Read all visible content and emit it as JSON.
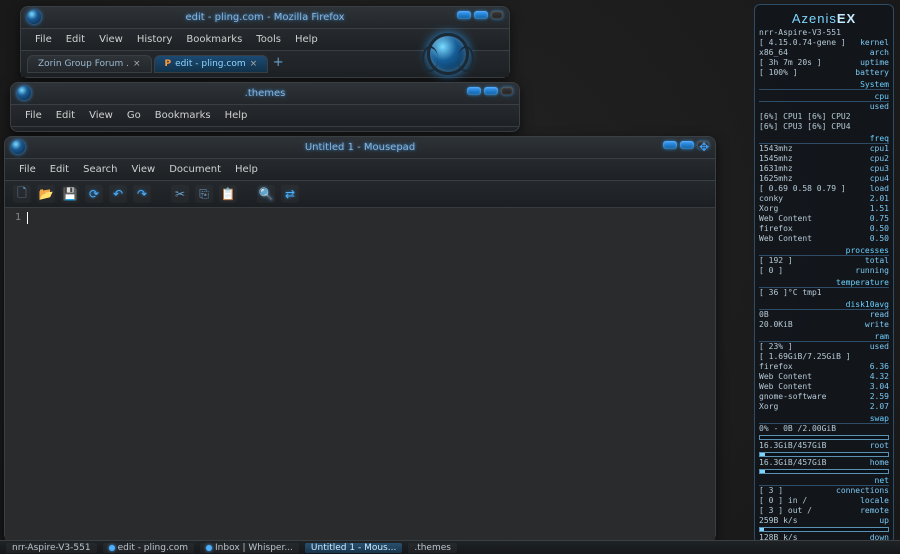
{
  "firefox": {
    "title": "edit - pling.com - Mozilla Firefox",
    "menu": [
      "File",
      "Edit",
      "View",
      "History",
      "Bookmarks",
      "Tools",
      "Help"
    ],
    "tabs": [
      {
        "label": "Zorin Group Forum .",
        "close": "×"
      },
      {
        "label": "edit - pling.com",
        "close": "×",
        "active": true
      }
    ],
    "plus": "+"
  },
  "filemanager": {
    "title": ".themes",
    "menu": [
      "File",
      "Edit",
      "View",
      "Go",
      "Bookmarks",
      "Help"
    ]
  },
  "mousepad": {
    "title": "Untitled 1 - Mousepad",
    "menu": [
      "File",
      "Edit",
      "Search",
      "View",
      "Document",
      "Help"
    ],
    "line": "1"
  },
  "conky": {
    "brand_a": "Azenis",
    "brand_b": "EX",
    "host": "nrr-Aspire-V3-551",
    "kernel_l": "[ 4.15.0.74-gene ]",
    "kernel_r": "kernel",
    "arch_l": "x86_64",
    "arch_r": "arch",
    "uptime_l": "[ 3h 7m 20s ]",
    "uptime_r": "uptime",
    "battery_l": "[ 100% ]",
    "battery_r": "battery",
    "h_system": "System",
    "h_cpu": "cpu",
    "cpu_used": "used",
    "cpu12": "[6%] CPU1  [6%] CPU2",
    "cpu34": "[6%] CPU3  [6%] CPU4",
    "h_freq": "freq",
    "f1": "1543mhz",
    "f1r": "cpu1",
    "f2": "1545mhz",
    "f2r": "cpu2",
    "f3": "1631mhz",
    "f3r": "cpu3",
    "f4": "1625mhz",
    "f4r": "cpu4",
    "load": "[ 0.69 0.58 0.79 ]",
    "load_r": "load",
    "p1": "conky",
    "p1v": "2.01",
    "p2": "Xorg",
    "p2v": "1.51",
    "p3": "Web Content",
    "p3v": "0.75",
    "p4": "firefox",
    "p4v": "0.50",
    "p5": "Web Content",
    "p5v": "0.50",
    "h_proc": "processes",
    "proc_total": "[ 192 ]",
    "proc_total_r": "total",
    "proc_run": "[ 0 ]",
    "proc_run_r": "running",
    "h_temp": "temperature",
    "temp": "[ 36 ]°C tmp1",
    "h_disk": "disk10avg",
    "disk_r": "0B",
    "disk_rr": "read",
    "disk_w": "20.0KiB",
    "disk_wr": "write",
    "h_ram": "ram",
    "ram_used": "[ 23% ]",
    "ram_used_r": "used",
    "ram_total": "[ 1.69GiB/7.25GiB ]",
    "r1": "firefox",
    "r1v": "6.36",
    "r2": "Web Content",
    "r2v": "4.32",
    "r3": "Web Content",
    "r3v": "3.04",
    "r4": "gnome-software",
    "r4v": "2.59",
    "r5": "Xorg",
    "r5v": "2.07",
    "h_swap": "swap",
    "swap": "0% - 0B  /2.00GiB",
    "root": "16.3GiB/457GiB",
    "root_r": "root",
    "home": "16.3GiB/457GiB",
    "home_r": "home",
    "h_net": "net",
    "net_conn": "[ 3 ]",
    "net_conn_r": "connections",
    "net_in": "[ 0 ] in /",
    "net_in_r": "locale",
    "net_out": "[ 3 ] out /",
    "net_out_r": "remote",
    "up": "259B   k/s",
    "up_r": "up",
    "down": "128B   k/s",
    "down_r": "down"
  },
  "taskbar": {
    "items": [
      {
        "label": "nrr-Aspire-V3-551"
      },
      {
        "label": "edit - pling.com"
      },
      {
        "label": "Inbox | Whisper..."
      },
      {
        "label": "Untitled 1 - Mous...",
        "active": true
      },
      {
        "label": ".themes"
      }
    ]
  }
}
